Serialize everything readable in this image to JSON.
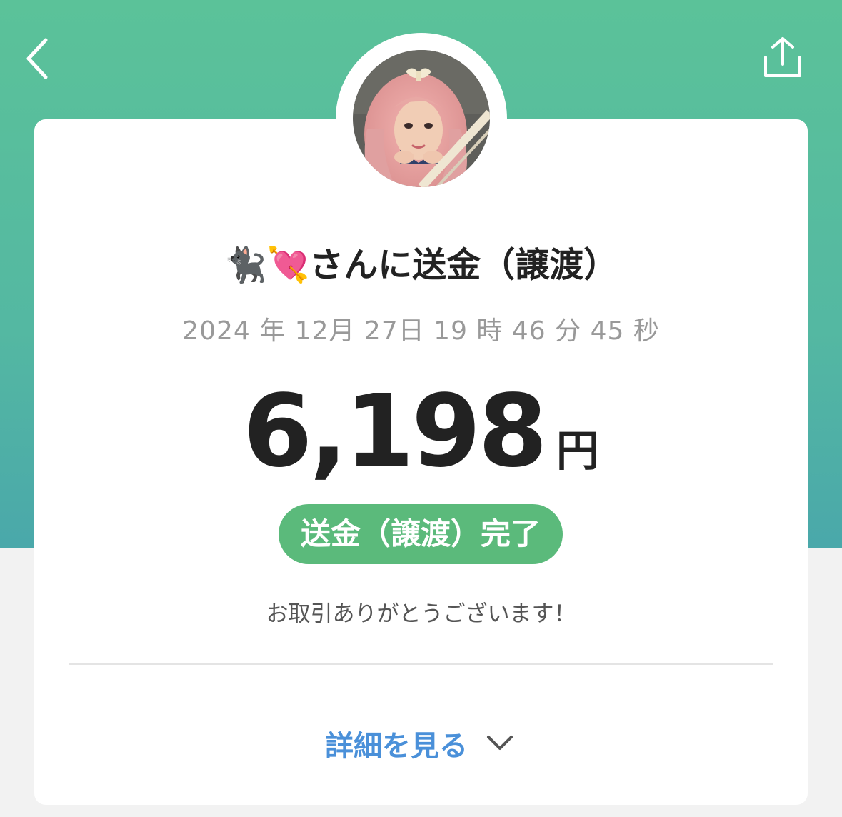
{
  "header": {
    "back_icon": "chevron-left-icon",
    "share_icon": "share-icon",
    "background_color": "#5bc299"
  },
  "recipient": {
    "emoji_1": "🐈‍⬛",
    "emoji_2": "💘",
    "title": "さんに送金（譲渡）"
  },
  "transaction": {
    "datetime": "2024 年 12月 27日 19 時 46 分 45 秒",
    "amount": "6,198",
    "currency": "円",
    "status": "送金（譲渡）完了",
    "status_color": "#5bba7b",
    "thanks_message": "お取引ありがとうございます！"
  },
  "details": {
    "label": "詳細を見る",
    "icon": "chevron-down-icon",
    "color": "#4a90d9"
  }
}
